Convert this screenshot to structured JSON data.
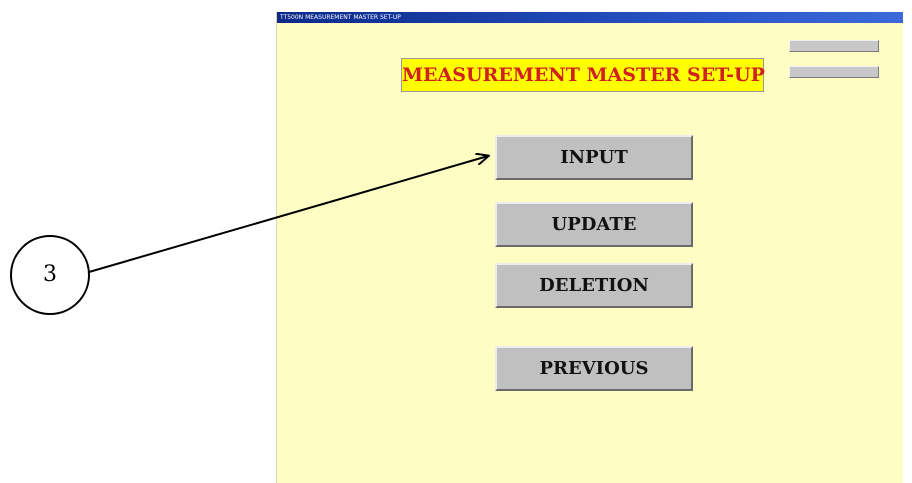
{
  "window": {
    "title": "TT500N MEASUREMENT MASTER SET-UP",
    "status_1": "",
    "status_2": ""
  },
  "screen": {
    "heading": "MEASUREMENT MASTER SET-UP"
  },
  "menu": {
    "input_label": "INPUT",
    "update_label": "UPDATE",
    "deletion_label": "DELETION",
    "previous_label": "PREVIOUS"
  },
  "callout": {
    "number": "3"
  },
  "colors": {
    "window_background": "#fdfdc4",
    "heading_background": "#ffff00",
    "heading_text": "#d02020",
    "button_face": "#c0c0c0",
    "titlebar": "#0b2a8a"
  }
}
